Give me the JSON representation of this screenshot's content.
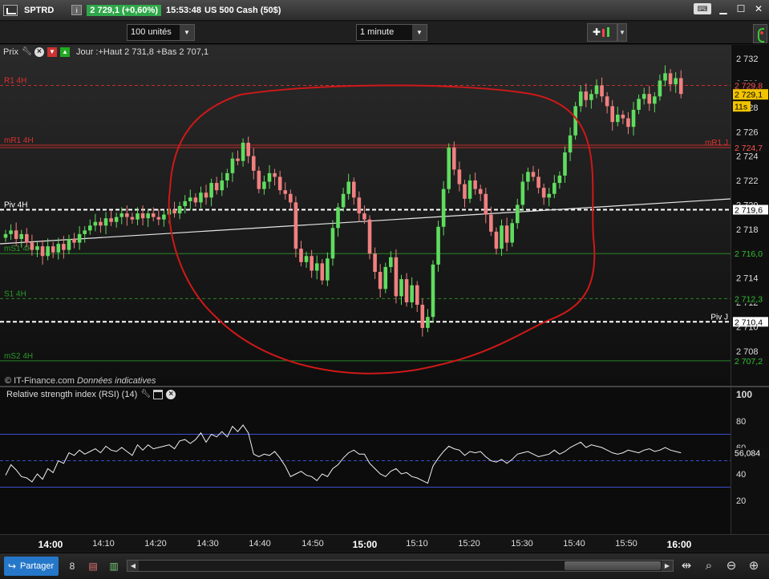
{
  "titlebar": {
    "symbol": "SPTRD",
    "info_label": "i",
    "price_change": "2 729,1 (+0,60%)",
    "time": "15:53:48",
    "instrument": "US 500 Cash (50$)"
  },
  "toolbar": {
    "units_value": "100 unités",
    "timeframe_value": "1 minute"
  },
  "price_pane": {
    "title": "Prix",
    "day_info": "Jour :+Haut 2 731,8 +Bas 2 707,1"
  },
  "rsi_pane": {
    "title": "Relative strength index (RSI) (14)"
  },
  "credit": {
    "source": "© IT-Finance.com",
    "note": "Données indicatives"
  },
  "bottombar": {
    "share_label": "Partager"
  },
  "colors": {
    "up_candle": "#5fdc5f",
    "down_candle": "#f08080",
    "resistance": "#e03030",
    "support": "#2a9a2a",
    "pivot": "#ffffff",
    "annotation": "#d01818"
  },
  "chart_data": [
    {
      "type": "candlestick",
      "x_ticks": [
        "14:00",
        "14:10",
        "14:20",
        "14:30",
        "14:40",
        "14:50",
        "15:00",
        "15:10",
        "15:20",
        "15:30",
        "15:40",
        "15:50",
        "16:00"
      ],
      "y_ticks": [
        "2 732",
        "2 730",
        "2 728",
        "2 726",
        "2 724",
        "2 722",
        "2 720",
        "2 718",
        "2 716",
        "2 714",
        "2 712",
        "2 710",
        "2 708"
      ],
      "ylim": [
        2706.8,
        2732.6
      ],
      "levels": [
        {
          "label": "R1 4H",
          "tag": "2 729,8",
          "value": 2729.8,
          "style": "dashed",
          "color": "#e03030"
        },
        {
          "label": "mR1 4H",
          "tag": "2 724,9",
          "value": 2724.9,
          "style": "solid",
          "color": "#e03030"
        },
        {
          "label": "mR1 J",
          "tag": "2 724,7",
          "value": 2724.7,
          "style": "solid",
          "color": "#e03030"
        },
        {
          "label": "Piv 4H",
          "tag": "2 719,6",
          "value": 2719.6,
          "style": "dashed",
          "color": "#ffffff"
        },
        {
          "label": "mS1 4H",
          "tag": "2 716,0",
          "value": 2716.0,
          "style": "solid",
          "color": "#2a9a2a"
        },
        {
          "label": "S1 4H",
          "tag": "2 712,3",
          "value": 2712.3,
          "style": "dashed",
          "color": "#2a9a2a"
        },
        {
          "label": "Piv J",
          "tag": "2 710,4",
          "value": 2710.4,
          "style": "dashed",
          "color": "#ffffff"
        },
        {
          "label": "mS2 4H",
          "tag": "2 707,2",
          "value": 2707.2,
          "style": "solid",
          "color": "#2a9a2a"
        }
      ],
      "last_price_tag": "2 729,1",
      "last_price": 2729.1,
      "countdown_tag": "11s",
      "closes": [
        2717.6,
        2717.9,
        2717.2,
        2717.6,
        2716.9,
        2716.3,
        2716.6,
        2715.8,
        2716.6,
        2716.1,
        2716.8,
        2716.3,
        2717.2,
        2716.9,
        2717.6,
        2717.9,
        2718.3,
        2718.6,
        2718.3,
        2718.9,
        2718.6,
        2719.0,
        2719.3,
        2719.0,
        2718.8,
        2719.3,
        2718.9,
        2719.3,
        2719.0,
        2718.8,
        2719.2,
        2719.6,
        2719.3,
        2719.9,
        2720.3,
        2720.6,
        2720.2,
        2721.0,
        2720.6,
        2721.8,
        2721.2,
        2722.0,
        2722.6,
        2723.8,
        2723.6,
        2725.1,
        2724.0,
        2722.8,
        2721.3,
        2721.9,
        2722.6,
        2722.3,
        2721.2,
        2720.9,
        2720.2,
        2716.4,
        2715.3,
        2715.8,
        2714.6,
        2715.2,
        2713.8,
        2715.6,
        2718.1,
        2719.8,
        2720.9,
        2721.9,
        2720.6,
        2719.3,
        2718.8,
        2716.0,
        2714.5,
        2713.1,
        2714.9,
        2715.7,
        2712.5,
        2713.9,
        2712.0,
        2713.4,
        2711.8,
        2709.9,
        2710.8,
        2715.1,
        2718.2,
        2721.3,
        2724.7,
        2722.9,
        2721.7,
        2720.5,
        2722.0,
        2721.3,
        2720.9,
        2719.2,
        2717.8,
        2716.4,
        2718.3,
        2716.9,
        2718.5,
        2720.0,
        2721.9,
        2722.7,
        2722.3,
        2721.4,
        2720.6,
        2720.9,
        2721.8,
        2722.4,
        2724.3,
        2725.7,
        2728.1,
        2729.3,
        2728.6,
        2729.1,
        2729.8,
        2728.9,
        2728.1,
        2726.8,
        2727.4,
        2727.1,
        2726.4,
        2727.8,
        2728.7,
        2729.1,
        2728.3,
        2728.9,
        2730.2,
        2730.8,
        2729.9,
        2730.4,
        2729.1
      ]
    },
    {
      "type": "line",
      "title": "Relative strength index (RSI) (14)",
      "y_ticks": [
        "100",
        "80",
        "60",
        "40",
        "20"
      ],
      "ylim": [
        0,
        100
      ],
      "bands": [
        30,
        50,
        70
      ],
      "last_value_tag": "56,084",
      "last_value": 56.084,
      "values": [
        39,
        47,
        43,
        38,
        37,
        34,
        40,
        36,
        44,
        41,
        50,
        48,
        56,
        54,
        58,
        55,
        57,
        59,
        56,
        61,
        58,
        57,
        60,
        57,
        54,
        62,
        58,
        62,
        59,
        60,
        61,
        62,
        59,
        65,
        66,
        63,
        66,
        71,
        64,
        70,
        68,
        72,
        68,
        76,
        72,
        77,
        71,
        55,
        53,
        55,
        54,
        57,
        52,
        46,
        38,
        40,
        42,
        39,
        38,
        35,
        40,
        38,
        44,
        47,
        52,
        56,
        58,
        55,
        55,
        48,
        44,
        40,
        38,
        42,
        44,
        40,
        41,
        38,
        37,
        35,
        33,
        46,
        52,
        57,
        61,
        59,
        58,
        54,
        57,
        56,
        57,
        53,
        50,
        49,
        51,
        48,
        51,
        55,
        56,
        57,
        55,
        53,
        54,
        55,
        58,
        55,
        57,
        60,
        62,
        64,
        60,
        62,
        61,
        60,
        58,
        56,
        55,
        56,
        58,
        57,
        56,
        58,
        59,
        57,
        58,
        60,
        58,
        57,
        56
      ]
    }
  ]
}
